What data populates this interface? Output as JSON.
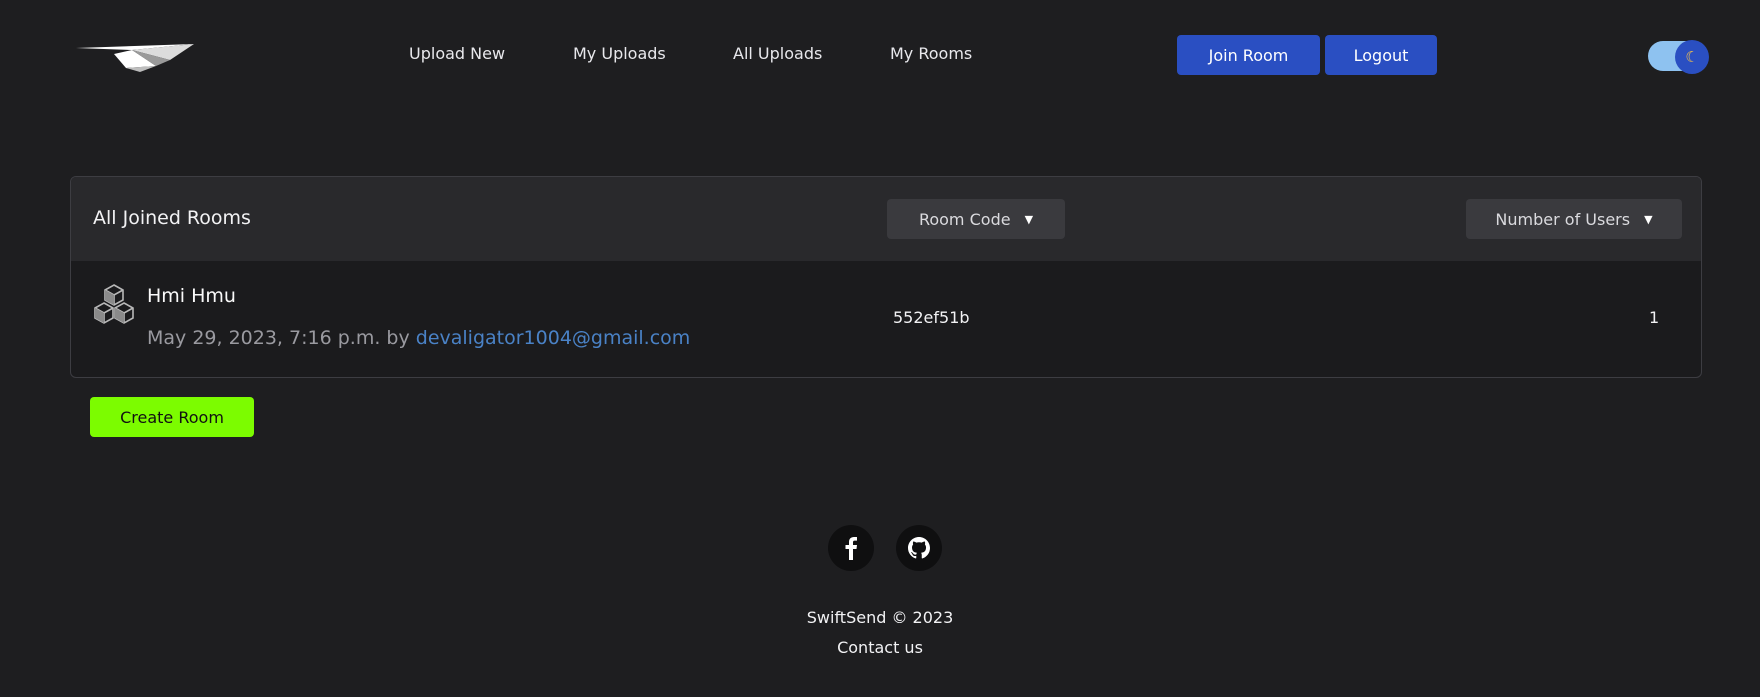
{
  "nav": {
    "links": [
      "Upload New",
      "My Uploads",
      "All Uploads",
      "My Rooms"
    ],
    "join_room": "Join Room",
    "logout": "Logout",
    "theme_toggle": {
      "mode": "dark",
      "icon": "moon-icon"
    }
  },
  "panel": {
    "title": "All Joined Rooms",
    "sort_room_code": "Room Code",
    "sort_users": "Number of Users",
    "rooms": [
      {
        "name": "Hmi Hmu",
        "date": "May 29, 2023, 7:16 p.m. by",
        "owner": "devaligator1004@gmail.com",
        "code": "552ef51b",
        "users": "1",
        "icon": "cubes-icon"
      }
    ]
  },
  "create_room": "Create Room",
  "footer": {
    "social": [
      "facebook-icon",
      "github-icon"
    ],
    "copyright": "SwiftSend © 2023",
    "contact": "Contact us"
  },
  "colors": {
    "background": "#1e1e20",
    "accent_blue": "#2a4fc2",
    "create_green": "#7cfc00",
    "email_link": "#4a82c6"
  }
}
